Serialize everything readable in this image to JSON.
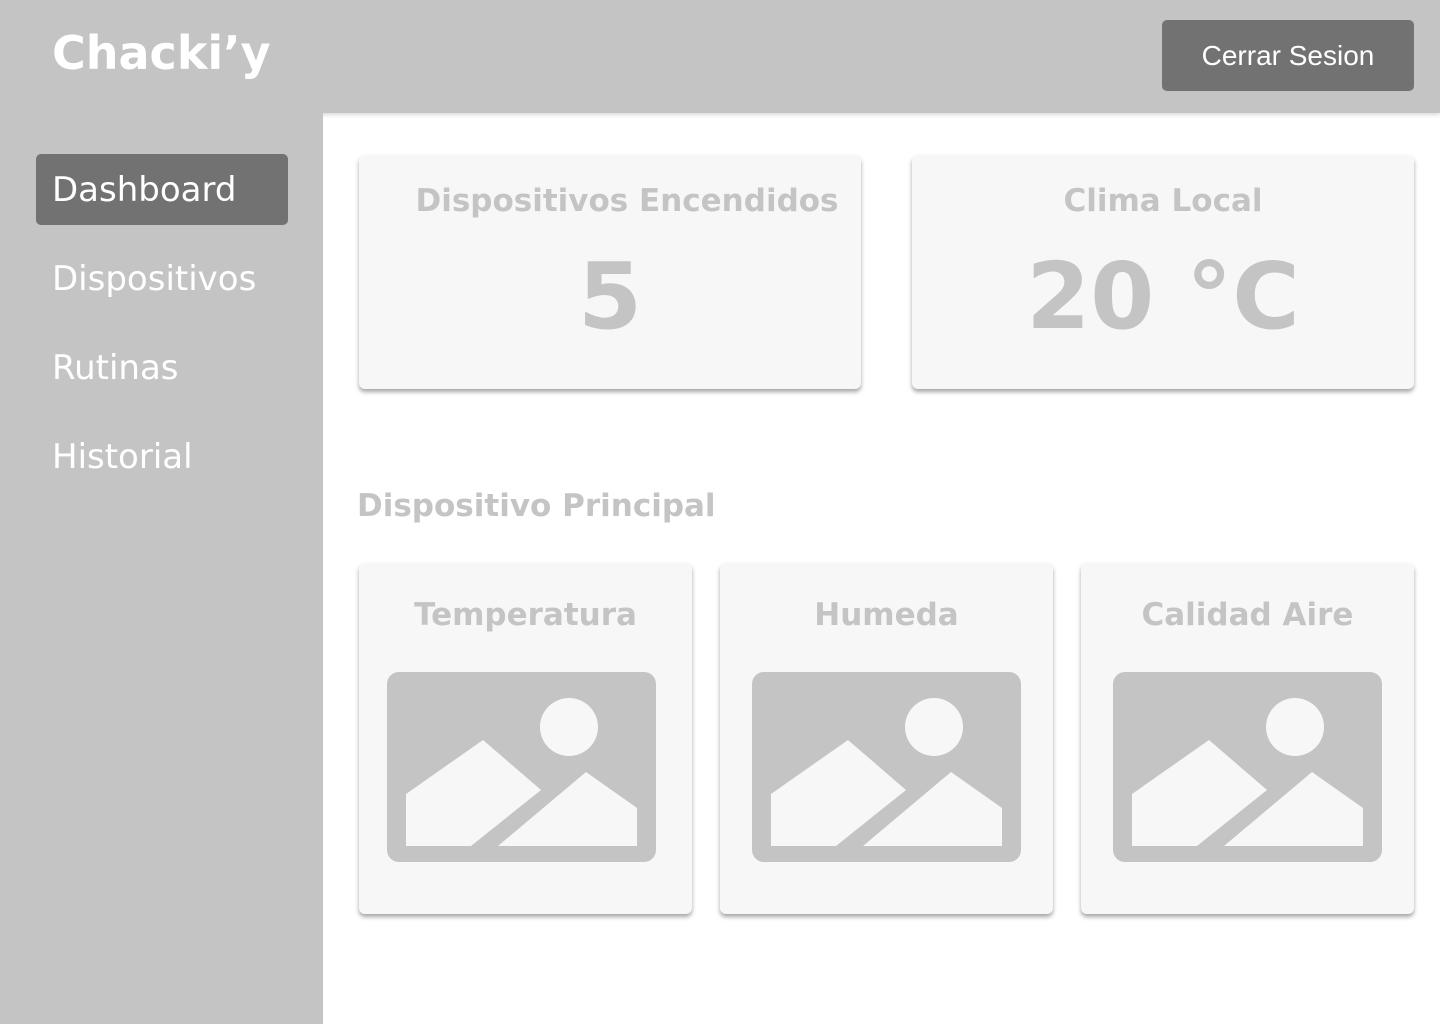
{
  "header": {
    "logo": "Chacki’y",
    "logout_label": "Cerrar Sesion"
  },
  "sidebar": {
    "items": [
      {
        "label": "Dashboard",
        "active": true
      },
      {
        "label": "Dispositivos"
      },
      {
        "label": "Rutinas"
      },
      {
        "label": "Historial"
      }
    ]
  },
  "stats": [
    {
      "title": "Dispositivos Encendidos",
      "value": "5"
    },
    {
      "title": "Clima Local",
      "value": "20 °C"
    }
  ],
  "section_title": "Dispositivo Principal",
  "sensors": [
    {
      "title": "Temperatura",
      "icon": "image-placeholder-icon"
    },
    {
      "title": "Humeda",
      "icon": "image-placeholder-icon"
    },
    {
      "title": "Calidad Aire",
      "icon": "image-placeholder-icon"
    }
  ]
}
